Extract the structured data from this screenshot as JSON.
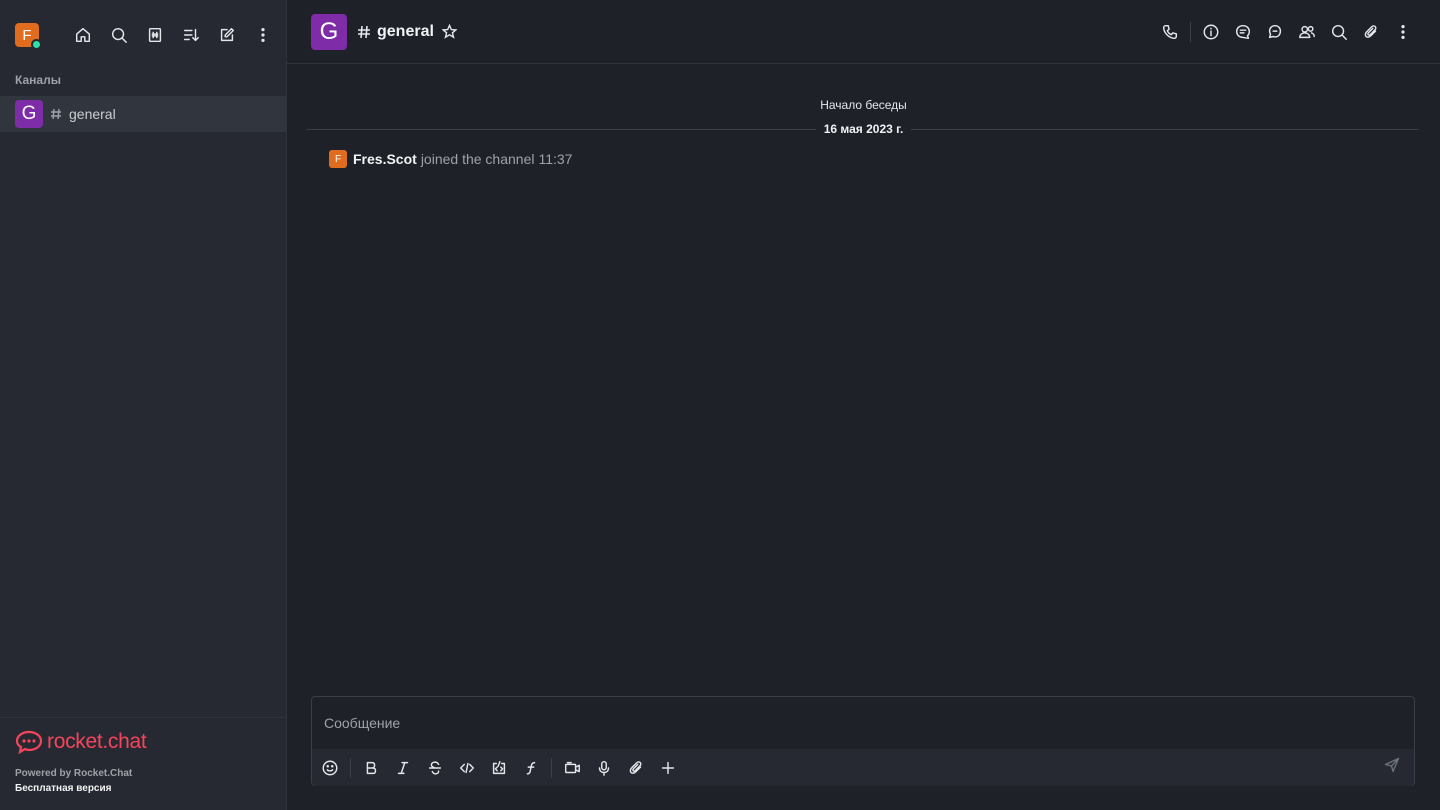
{
  "sidebar": {
    "user_initial": "F",
    "user_status": "online",
    "actions": [
      {
        "name": "home-button",
        "icon": "home-icon"
      },
      {
        "name": "search-button",
        "icon": "search-icon"
      },
      {
        "name": "directory-button",
        "icon": "directory-icon"
      },
      {
        "name": "sort-button",
        "icon": "sort-icon"
      },
      {
        "name": "create-new-button",
        "icon": "pencil-icon"
      },
      {
        "name": "more-button",
        "icon": "kebab-icon"
      }
    ],
    "section_title": "Каналы",
    "rooms": [
      {
        "initial": "G",
        "name": "general"
      }
    ],
    "footer": {
      "logo_text": "rocket.chat",
      "powered_by": "Powered by Rocket.Chat",
      "edition": "Бесплатная версия"
    }
  },
  "header": {
    "room_initial": "G",
    "room_name": "general",
    "actions": [
      "phone-icon",
      "info-icon",
      "threads-icon",
      "discussions-icon",
      "members-icon",
      "search-icon",
      "attachment-icon",
      "kebab-icon"
    ]
  },
  "messages": {
    "conversation_start": "Начало беседы",
    "date": "16 мая 2023 г.",
    "system": {
      "avatar_initial": "F",
      "user": "Fres.Scot",
      "text": "joined the channel",
      "time": "11:37"
    }
  },
  "composer": {
    "placeholder": "Сообщение"
  },
  "colors": {
    "brand": "#f5455c",
    "channel_avatar": "#7e2ca8",
    "user_avatar": "#e06c1e",
    "online": "#2de0a5"
  }
}
